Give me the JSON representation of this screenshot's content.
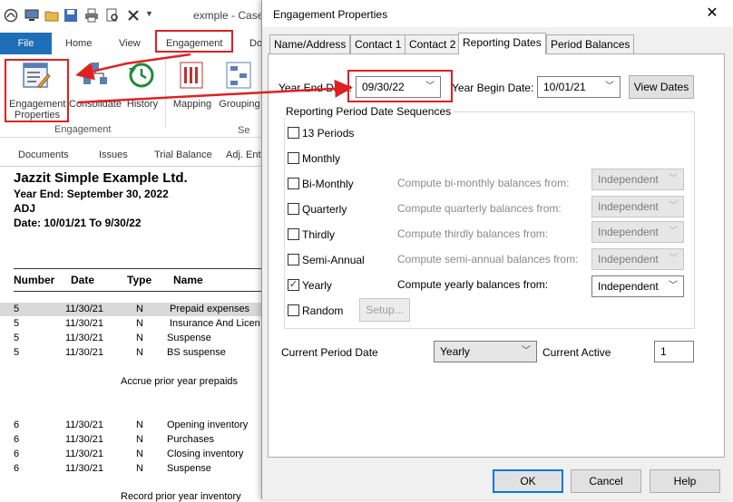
{
  "app": {
    "title": "exmple - CaseWare",
    "file_tab": "File",
    "ribbon_tabs": [
      "Home",
      "View",
      "Engagement",
      "Do"
    ],
    "group_label": "Engagement",
    "group_label2": "Se",
    "buttons": {
      "engagement_properties": "Engagement Properties",
      "consolidate": "Consolidate",
      "history": "History",
      "mapping": "Mapping",
      "grouping": "Grouping"
    },
    "nav_tabs": [
      "Documents",
      "Issues",
      "Trial Balance",
      "Adj. Ent"
    ]
  },
  "document": {
    "company": "Jazzit Simple Example Ltd.",
    "year_end": "Year End: September 30, 2022",
    "adj": "ADJ",
    "date_range": "Date:  10/01/21  To  9/30/22",
    "columns": [
      "Number",
      "Date",
      "Type",
      "Name"
    ],
    "rows_a": [
      {
        "number": "5",
        "date": "11/30/21",
        "type": "N",
        "name": "Prepaid expenses"
      },
      {
        "number": "5",
        "date": "11/30/21",
        "type": "N",
        "name": "Insurance And Licen"
      },
      {
        "number": "5",
        "date": "11/30/21",
        "type": "N",
        "name": "Suspense"
      },
      {
        "number": "5",
        "date": "11/30/21",
        "type": "N",
        "name": "BS suspense"
      }
    ],
    "note_a": "Accrue prior year prepaids",
    "rows_b": [
      {
        "number": "6",
        "date": "11/30/21",
        "type": "N",
        "name": "Opening inventory"
      },
      {
        "number": "6",
        "date": "11/30/21",
        "type": "N",
        "name": "Purchases"
      },
      {
        "number": "6",
        "date": "11/30/21",
        "type": "N",
        "name": "Closing inventory"
      },
      {
        "number": "6",
        "date": "11/30/21",
        "type": "N",
        "name": "Suspense"
      }
    ],
    "note_b": "Record prior year inventory"
  },
  "dialog": {
    "title": "Engagement Properties",
    "close": "✕",
    "tabs": [
      "Name/Address",
      "Contact 1",
      "Contact 2",
      "Reporting Dates",
      "Period Balances"
    ],
    "year_end_label": "Year End Date:",
    "year_end_value": "09/30/22",
    "year_begin_label": "Year Begin Date:",
    "year_begin_value": "10/01/21",
    "view_dates": "View Dates",
    "group_title": "Reporting Period Date Sequences",
    "sequences": [
      {
        "label": "13 Periods",
        "checked": false,
        "compute": "",
        "value": ""
      },
      {
        "label": "Monthly",
        "checked": false,
        "compute": "",
        "value": ""
      },
      {
        "label": "Bi-Monthly",
        "checked": false,
        "compute": "Compute bi-monthly balances from:",
        "value": "Independent"
      },
      {
        "label": "Quarterly",
        "checked": false,
        "compute": "Compute quarterly balances from:",
        "value": "Independent"
      },
      {
        "label": "Thirdly",
        "checked": false,
        "compute": "Compute thirdly balances from:",
        "value": "Independent"
      },
      {
        "label": "Semi-Annual",
        "checked": false,
        "compute": "Compute semi-annual balances from:",
        "value": "Independent"
      },
      {
        "label": "Yearly",
        "checked": true,
        "compute": "Compute yearly balances from:",
        "value": "Independent"
      },
      {
        "label": "Random",
        "checked": false,
        "compute": "",
        "value": ""
      }
    ],
    "setup": "Setup...",
    "current_period_label": "Current Period Date",
    "current_period_value": "Yearly",
    "current_active_label": "Current Active",
    "current_active_value": "1",
    "ok": "OK",
    "cancel": "Cancel",
    "help": "Help"
  },
  "colors": {
    "accent": "#1e6fb8",
    "annotation": "#e02020",
    "focus": "#0078d7"
  }
}
